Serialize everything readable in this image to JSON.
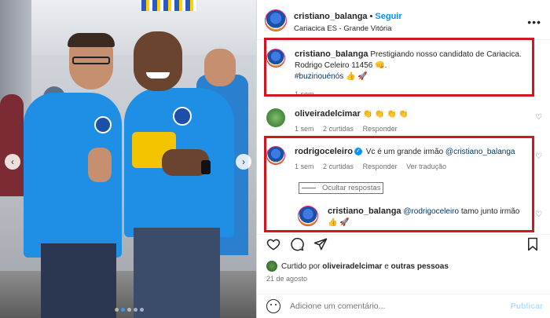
{
  "post": {
    "username": "cristiano_balanga",
    "separator": "•",
    "follow_label": "Seguir",
    "location": "Cariacica ES - Grande Vitória",
    "more_label": "•••"
  },
  "caption": {
    "username": "cristiano_balanga",
    "text": "Prestigiando nosso candidato de Cariacica. Rodrigo Celeiro 11456 👊.",
    "hashtag": "#buzinouénós",
    "hashtag_emojis": "👍 🚀",
    "time": "1 sem"
  },
  "comments": [
    {
      "username": "oliveiradelcimar",
      "text": "👏 👏 👏 👏",
      "time": "1 sem",
      "likes": "2 curtidas",
      "reply": "Responder"
    },
    {
      "username": "rodrigoceleiro",
      "text": "Vc é um grande irmão",
      "mention": "@cristiano_balanga",
      "time": "1 sem",
      "likes": "2 curtidas",
      "reply": "Responder",
      "translate": "Ver tradução"
    }
  ],
  "hide_replies_label": "Ocultar respostas",
  "reply": {
    "username": "cristiano_balanga",
    "mention": "@rodrigoceleiro",
    "text": "tamo junto irmão",
    "emojis": "👍 🚀"
  },
  "likes": {
    "prefix": "Curtido por",
    "user": "oliveiradelcimar",
    "connector": "e",
    "others": "outras pessoas"
  },
  "date": "21 de agosto",
  "add_comment": {
    "placeholder": "Adicione um comentário...",
    "publish_label": "Publicar"
  },
  "colors": {
    "accent": "#0095f6",
    "highlight": "#d0161f",
    "shirt": "#1f8fe5"
  }
}
